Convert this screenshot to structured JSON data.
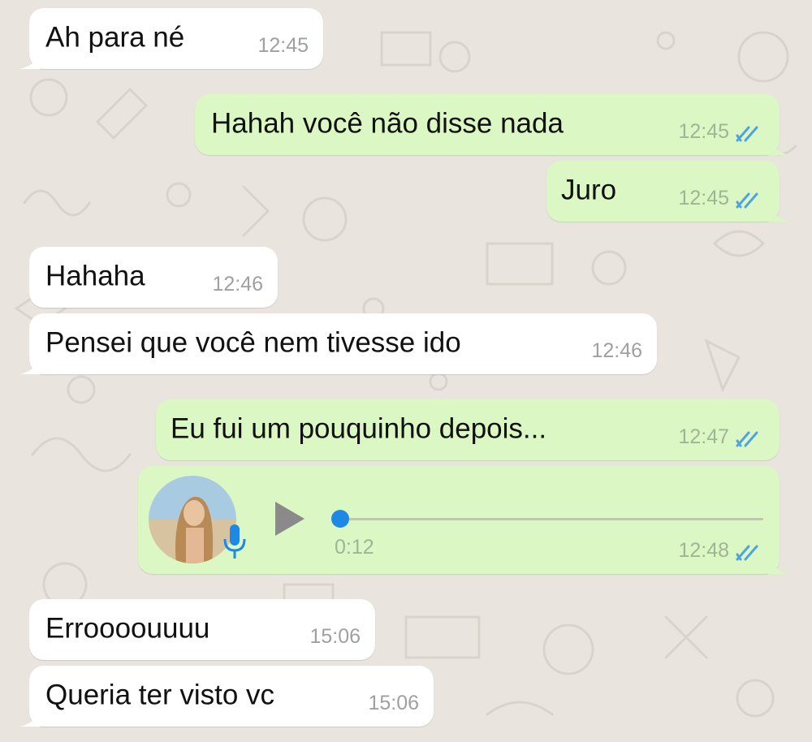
{
  "chat": {
    "messages": [
      {
        "direction": "incoming",
        "text": "Ah para né",
        "time": "12:45"
      },
      {
        "direction": "outgoing",
        "text": "Hahah você não disse nada",
        "time": "12:45",
        "status": "read"
      },
      {
        "direction": "outgoing",
        "text": "Juro",
        "time": "12:45",
        "status": "read"
      },
      {
        "direction": "incoming",
        "text": "Hahaha",
        "time": "12:46"
      },
      {
        "direction": "incoming",
        "text": "Pensei que você nem tivesse ido",
        "time": "12:46"
      },
      {
        "direction": "outgoing",
        "text": "Eu fui um pouquinho depois...",
        "time": "12:47",
        "status": "read"
      },
      {
        "direction": "outgoing",
        "type": "voice",
        "duration": "0:12",
        "time": "12:48",
        "status": "read",
        "progress": 0.0
      },
      {
        "direction": "incoming",
        "text": "Erroooouuuu",
        "time": "15:06"
      },
      {
        "direction": "incoming",
        "text": "Queria ter visto vc",
        "time": "15:06"
      }
    ]
  },
  "colors": {
    "wallpaper": "#e9e5de",
    "incoming_bubble": "#ffffff",
    "outgoing_bubble": "#dbf7c3",
    "read_ticks": "#4fa3e0",
    "voice_accent": "#1e88e5"
  },
  "icons": [
    "read-receipt-double-check-icon",
    "play-icon",
    "microphone-icon"
  ]
}
